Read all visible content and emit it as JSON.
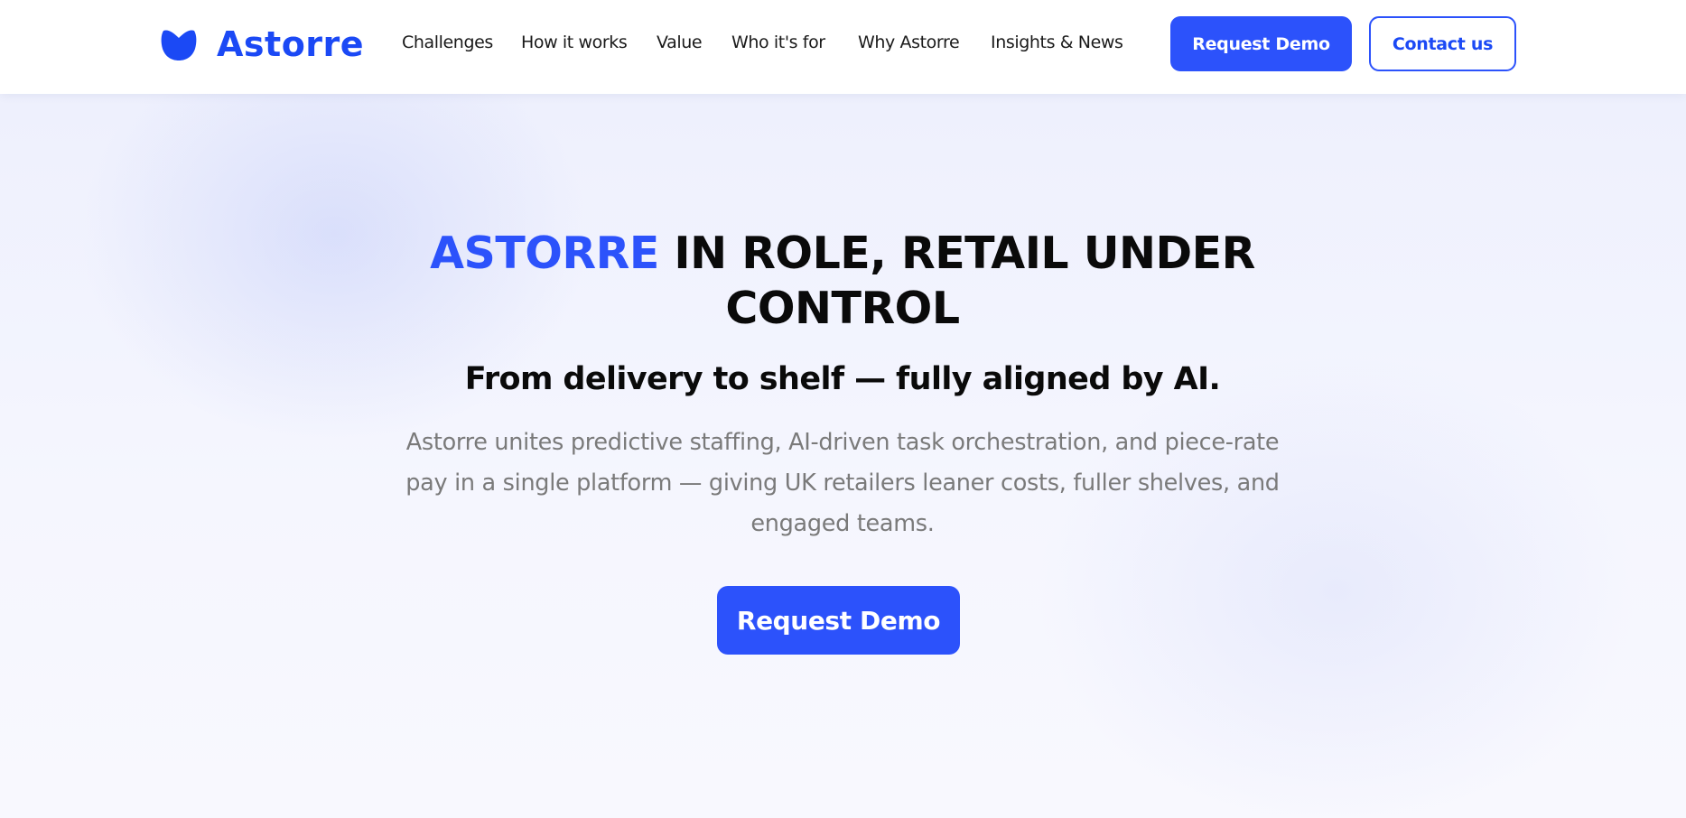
{
  "header": {
    "logo_text": "Astorre",
    "nav": [
      {
        "label": "Challenges"
      },
      {
        "label": "How it works"
      },
      {
        "label": "Value"
      },
      {
        "label": "Who it's for"
      },
      {
        "label": "Why Astorre"
      },
      {
        "label": "Insights & News"
      }
    ],
    "request_demo_label": "Request Demo",
    "contact_label": "Contact us"
  },
  "hero": {
    "title_accent": "ASTORRE",
    "title_rest": " IN ROLE, RETAIL UNDER CONTROL",
    "subtitle": "From delivery to shelf — fully aligned by AI.",
    "description": "Astorre unites predictive staffing, AI-driven task orchestration, and piece-rate pay in a single platform — giving UK retailers leaner costs, fuller shelves, and engaged teams.",
    "cta_label": "Request Demo"
  },
  "colors": {
    "accent": "#2c52fb",
    "logo": "#1b49f5",
    "text": "#0a0a0a",
    "muted_text": "#7a7a7a",
    "hero_background": "#f2f4fe"
  },
  "icons": {
    "logo": "astorre-logo-icon"
  }
}
